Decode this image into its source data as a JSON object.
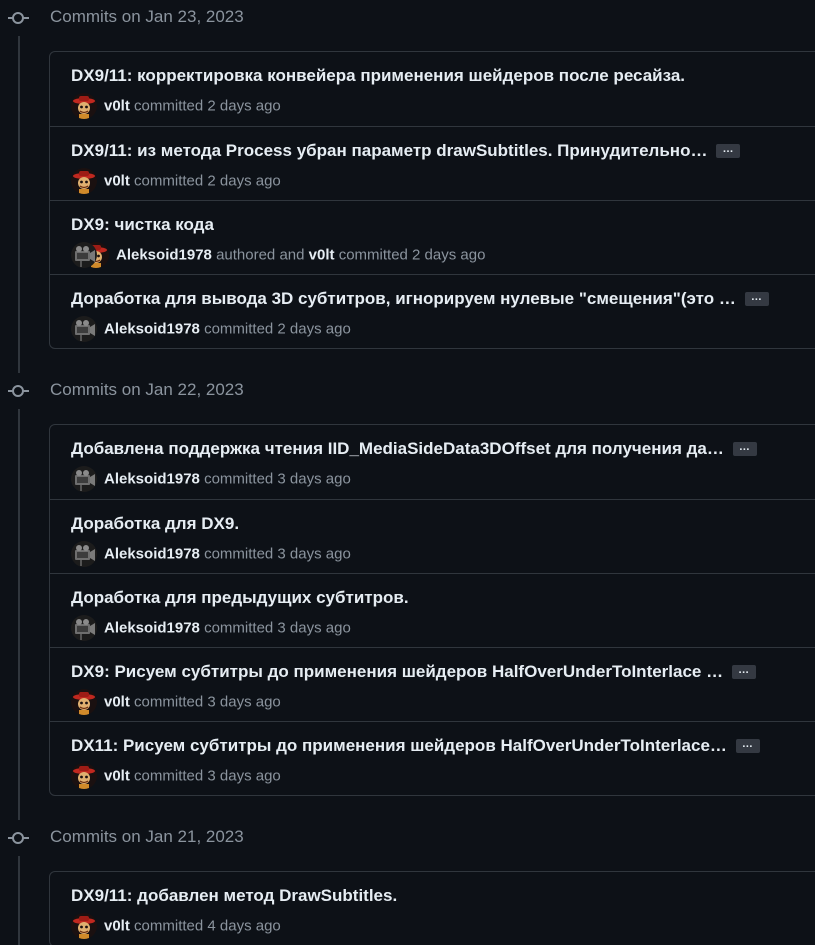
{
  "groups": [
    {
      "date_label": "Commits on Jan 23, 2023",
      "commits": [
        {
          "message": "DX9/11: корректировка конвейера применения шейдеров после ресайза.",
          "truncated": false,
          "ellipsis": "",
          "author": "v0lt",
          "avatar": "v0lt-avatar",
          "action": "committed",
          "time": "2 days ago"
        },
        {
          "message": "DX9/11: из метода Process убран параметр drawSubtitles. Принудительно…",
          "truncated": true,
          "ellipsis": "…",
          "author": "v0lt",
          "avatar": "v0lt-avatar",
          "action": "committed",
          "time": "2 days ago"
        },
        {
          "message": "DX9: чистка кода",
          "truncated": false,
          "ellipsis": "",
          "author": "Aleksoid1978",
          "avatar": "aleksoid-avatar",
          "action": "authored and",
          "committer": "v0lt",
          "committer_action": "committed",
          "time": "2 days ago"
        },
        {
          "message": "Доработка для вывода 3D субтитров, игнорируем нулевые \"смещения\"(это …",
          "truncated": true,
          "ellipsis": "…",
          "author": "Aleksoid1978",
          "avatar": "aleksoid-avatar",
          "action": "committed",
          "time": "2 days ago"
        }
      ]
    },
    {
      "date_label": "Commits on Jan 22, 2023",
      "commits": [
        {
          "message": "Добавлена поддержка чтения IID_MediaSideData3DOffset для получения да…",
          "truncated": true,
          "ellipsis": "…",
          "author": "Aleksoid1978",
          "avatar": "aleksoid-avatar",
          "action": "committed",
          "time": "3 days ago"
        },
        {
          "message": "Доработка для DX9.",
          "truncated": false,
          "ellipsis": "",
          "author": "Aleksoid1978",
          "avatar": "aleksoid-avatar",
          "action": "committed",
          "time": "3 days ago"
        },
        {
          "message": "Доработка для предыдущих субтитров.",
          "truncated": false,
          "ellipsis": "",
          "author": "Aleksoid1978",
          "avatar": "aleksoid-avatar",
          "action": "committed",
          "time": "3 days ago"
        },
        {
          "message": "DX9: Рисуем субтитры до применения шейдеров HalfOverUnderToInterlace …",
          "truncated": true,
          "ellipsis": "…",
          "author": "v0lt",
          "avatar": "v0lt-avatar",
          "action": "committed",
          "time": "3 days ago"
        },
        {
          "message": "DX11: Рисуем субтитры до применения шейдеров HalfOverUnderToInterlace…",
          "truncated": true,
          "ellipsis": "…",
          "author": "v0lt",
          "avatar": "v0lt-avatar",
          "action": "committed",
          "time": "3 days ago"
        }
      ]
    },
    {
      "date_label": "Commits on Jan 21, 2023",
      "commits": [
        {
          "message": "DX9/11: добавлен метод DrawSubtitles.",
          "truncated": false,
          "ellipsis": "",
          "author": "v0lt",
          "avatar": "v0lt-avatar",
          "action": "committed",
          "time": "4 days ago"
        }
      ]
    }
  ],
  "colors": {
    "background": "#0d1117",
    "border": "#30363d",
    "text_primary": "#e6edf3",
    "text_muted": "#8b949e",
    "ellipsis_bg": "#343942"
  },
  "icons": {
    "timeline": "git-commit-icon",
    "expand": "ellipsis-icon"
  }
}
